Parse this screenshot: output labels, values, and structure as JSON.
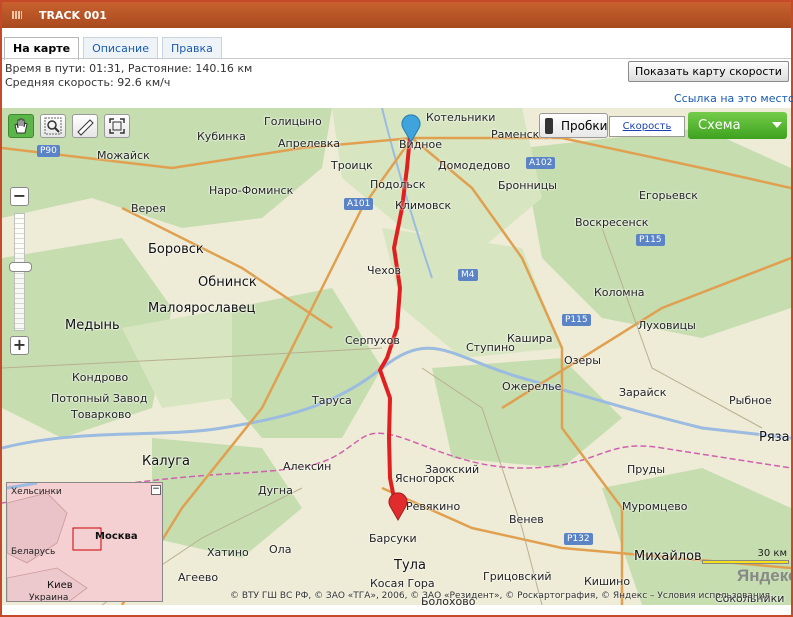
{
  "window": {
    "title": "TRACK 001"
  },
  "tabs": [
    {
      "label": "На карте",
      "active": true
    },
    {
      "label": "Описание",
      "active": false
    },
    {
      "label": "Правка",
      "active": false
    }
  ],
  "info": {
    "line1": "Время в пути: 01:31, Растояние: 140.16 км",
    "line2": "Средняя скорость: 92.6 км/ч"
  },
  "buttons": {
    "speed_map": "Показать карту скорости",
    "link_here": "Ссылка на это место",
    "traffic": "Пробки",
    "speed": "Скорость",
    "scheme": "Схема"
  },
  "map": {
    "cities": [
      "Котельники",
      "Раменское",
      "Голицыно",
      "Апрелевка",
      "Видное",
      "Домодедово",
      "Можайск",
      "Кубинка",
      "Троицк",
      "Бронницы",
      "Подольск",
      "Наро-Фоминск",
      "Верея",
      "Климовск",
      "Егорьевск",
      "Воскресенск",
      "Боровск",
      "Обнинск",
      "Чехов",
      "Коломна",
      "Медынь",
      "Малоярославец",
      "Луховицы",
      "Серпухов",
      "Ступино",
      "Кашира",
      "Озеры",
      "Кондрово",
      "Ожерелье",
      "Зарайск",
      "Рыбное",
      "Потопный Завод",
      "Товарково",
      "Таруса",
      "Калуга",
      "Алексин",
      "Ясногорск",
      "Пруды",
      "Дугна",
      "Венев",
      "Ряза",
      "Барсуки",
      "Михайлов",
      "Хатино",
      "Агеево",
      "Тула",
      "Косая Гора",
      "Грицовский",
      "Болохово",
      "Сокольники",
      "Заокский",
      "Ревякино",
      "Ола",
      "Муромцево",
      "Кишино"
    ],
    "shields": [
      "P90",
      "A101",
      "A102",
      "M4",
      "P115",
      "P115",
      "P132"
    ],
    "copyright": "© ВТУ ГШ ВС РФ, © ЗАО «ТГА», 2006, © ЗАО «Резидент», © Роскартография, © Яндекс – Условия использования",
    "scale_label": "30 км",
    "logo": "Яндекс"
  },
  "minimap": {
    "labels": [
      "Хельсинки",
      "Москва",
      "Беларусь",
      "Киев",
      "Украина"
    ]
  },
  "colors": {
    "titlebar": "#b2552a",
    "route": "#e02020",
    "scheme_button": "#4fb32c"
  }
}
